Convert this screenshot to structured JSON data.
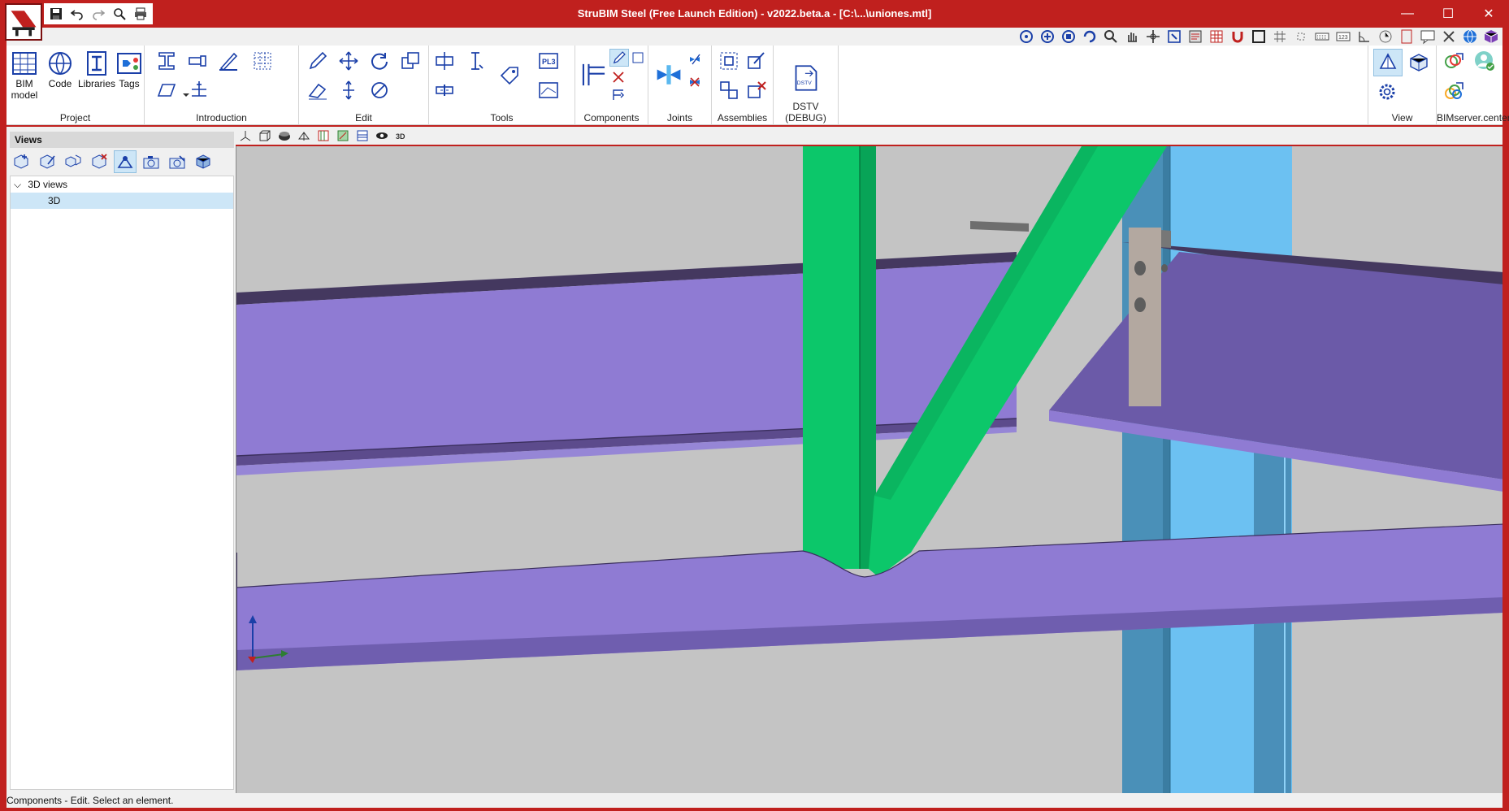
{
  "window": {
    "title": "StruBIM Steel (Free Launch Edition) - v2022.beta.a - [C:\\...\\uniones.mtl]",
    "minimize": "—",
    "maximize": "☐",
    "close": "✕"
  },
  "ribbon": {
    "project": {
      "label": "Project",
      "bim_model": "BIM model",
      "code": "Code",
      "libraries": "Libraries",
      "tags": "Tags"
    },
    "introduction": {
      "label": "Introduction"
    },
    "edit": {
      "label": "Edit"
    },
    "tools": {
      "label": "Tools",
      "pl3": "PL3"
    },
    "components": {
      "label": "Components"
    },
    "joints": {
      "label": "Joints"
    },
    "assemblies": {
      "label": "Assemblies"
    },
    "dstv": {
      "label": "DSTV (DEBUG)",
      "icon_text": "DSTV"
    },
    "view": {
      "label": "View"
    },
    "bimserver": {
      "label": "BIMserver.center"
    }
  },
  "views_panel": {
    "header": "Views",
    "tree": [
      {
        "label": "3D views"
      },
      {
        "label": "3D"
      }
    ]
  },
  "viewport_toolbar": {
    "mode_3d": "3D"
  },
  "status": {
    "text": "Components - Edit. Select an element."
  },
  "colors": {
    "titlebar": "#c0201e",
    "beam_purple": "#8e7ccf",
    "diagonal_green": "#0cc76a",
    "column_blue": "#5bb8ef",
    "selection_blue": "#cde6f7"
  }
}
